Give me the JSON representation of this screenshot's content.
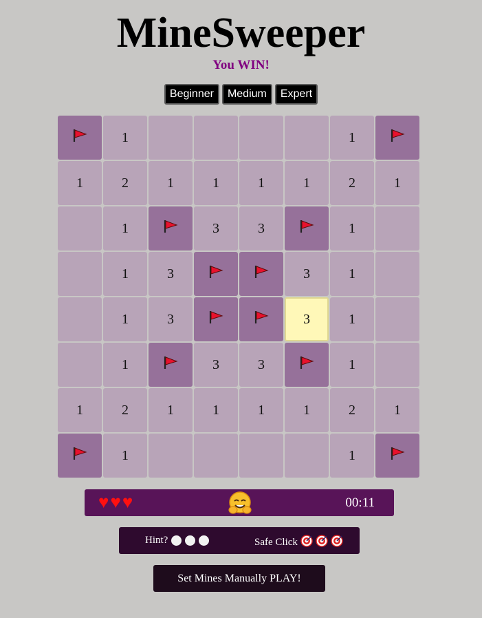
{
  "title": "MineSweeper",
  "status": "You WIN!",
  "levels": [
    "Beginner",
    "Medium",
    "Expert"
  ],
  "board": [
    [
      "F",
      "1",
      "",
      "",
      "",
      "",
      "1",
      "F"
    ],
    [
      "1",
      "2",
      "1",
      "1",
      "1",
      "1",
      "2",
      "1"
    ],
    [
      "",
      "1",
      "F",
      "3",
      "3",
      "F",
      "1",
      ""
    ],
    [
      "",
      "1",
      "3",
      "F",
      "F",
      "3",
      "1",
      ""
    ],
    [
      "",
      "1",
      "3",
      "F",
      "F",
      "3*",
      "1",
      ""
    ],
    [
      "",
      "1",
      "F",
      "3",
      "3",
      "F",
      "1",
      ""
    ],
    [
      "1",
      "2",
      "1",
      "1",
      "1",
      "1",
      "2",
      "1"
    ],
    [
      "F",
      "1",
      "",
      "",
      "",
      "",
      "1",
      "F"
    ]
  ],
  "colors": {
    "cell": "#b8a4b8",
    "flagged_cell": "#96719a",
    "highlight_cell": "#fff8b8",
    "status": "#800080",
    "status_bar": "#581458"
  },
  "lives": "♥♥♥",
  "face_icon": "hugging-face-emoji",
  "timer": "00:11",
  "hint_label": "Hint?",
  "hints_remaining": 3,
  "safe_click_label": "Safe Click",
  "safe_clicks_remaining": 3,
  "play_button": "Set Mines Manually PLAY!"
}
